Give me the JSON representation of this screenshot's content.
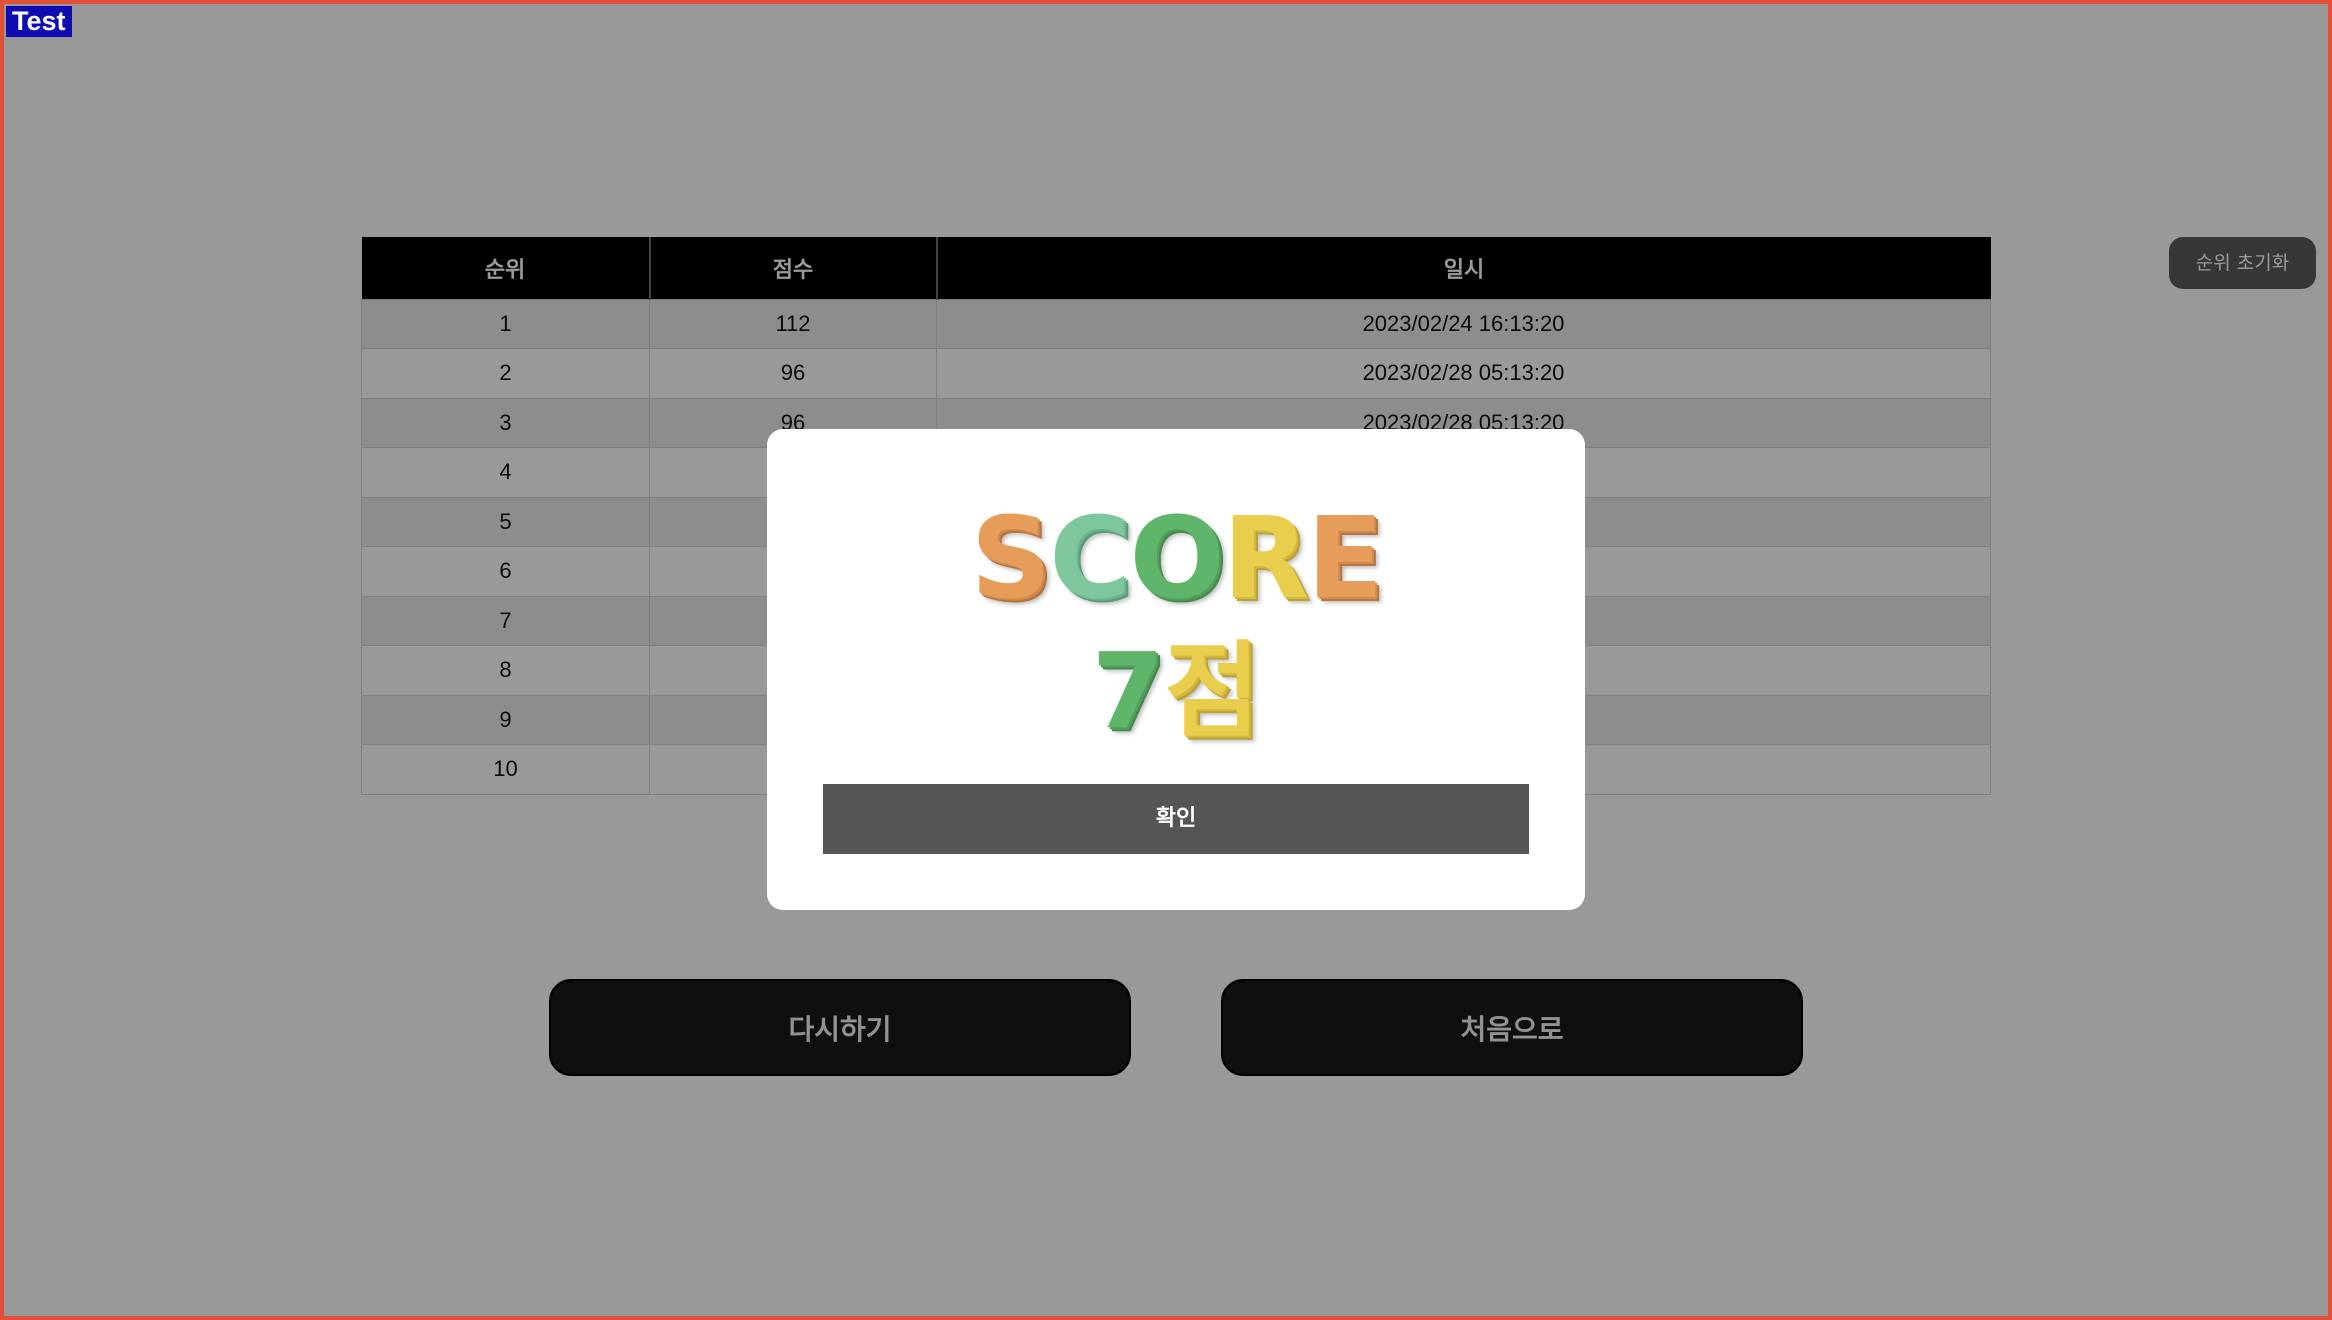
{
  "badge": "Test",
  "ranking": {
    "headers": [
      "순위",
      "점수",
      "일시"
    ],
    "rows": [
      {
        "rank": "1",
        "score": "112",
        "date": "2023/02/24 16:13:20"
      },
      {
        "rank": "2",
        "score": "96",
        "date": "2023/02/28 05:13:20"
      },
      {
        "rank": "3",
        "score": "96",
        "date": "2023/02/28 05:13:20"
      },
      {
        "rank": "4",
        "score": "",
        "date": ""
      },
      {
        "rank": "5",
        "score": "",
        "date": ""
      },
      {
        "rank": "6",
        "score": "",
        "date": ""
      },
      {
        "rank": "7",
        "score": "",
        "date": ""
      },
      {
        "rank": "8",
        "score": "",
        "date": ""
      },
      {
        "rank": "9",
        "score": "",
        "date": ""
      },
      {
        "rank": "10",
        "score": "",
        "date": ""
      }
    ],
    "reset_label": "순위 초기화"
  },
  "actions": {
    "retry_label": "다시하기",
    "home_label": "처음으로"
  },
  "modal": {
    "title_letters": [
      "S",
      "C",
      "O",
      "R",
      "E"
    ],
    "score_number": "7",
    "score_unit": "점",
    "confirm_label": "확인"
  },
  "colors": {
    "frame_border": "#e05238",
    "badge_bg": "#0f0cb4",
    "orange": "#e79d5a",
    "green": "#7ec79c",
    "dark_green": "#5fb56a",
    "yellow": "#e8ce4c",
    "confirm_bg": "#555555"
  }
}
